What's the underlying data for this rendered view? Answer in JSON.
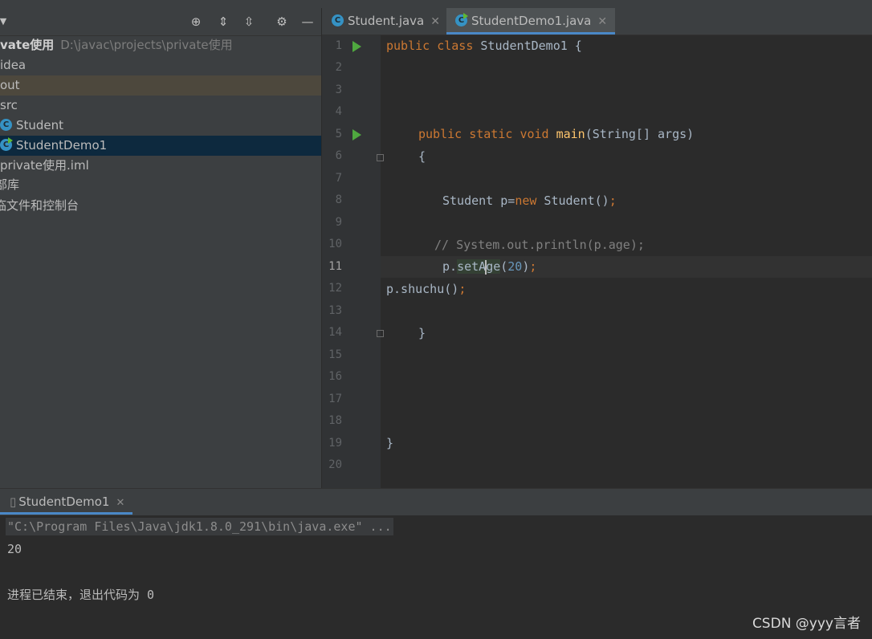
{
  "project": {
    "root_name": "vate使用",
    "root_path": "D:\\javac\\projects\\private使用",
    "items": [
      {
        "label": "idea"
      },
      {
        "label": "out"
      },
      {
        "label": "src"
      },
      {
        "label": "Student"
      },
      {
        "label": "StudentDemo1"
      },
      {
        "label": "private使用.iml"
      },
      {
        "label": "部库"
      },
      {
        "label": "临文件和控制台"
      }
    ]
  },
  "tabs": [
    {
      "label": "Student.java"
    },
    {
      "label": "StudentDemo1.java"
    }
  ],
  "editor": {
    "line_numbers": [
      "1",
      "2",
      "3",
      "4",
      "5",
      "6",
      "7",
      "8",
      "9",
      "10",
      "11",
      "12",
      "13",
      "14",
      "15",
      "16",
      "17",
      "18",
      "19",
      "20"
    ],
    "current_line": "11"
  },
  "code": {
    "l1_kw1": "public",
    "l1_kw2": "class",
    "l1_rest": "StudentDemo1 {",
    "l5_kw1": "public",
    "l5_kw2": "static",
    "l5_kw3": "void",
    "l5_fn": "main",
    "l5_rest": "(String[] args)",
    "l6": "{",
    "l8_a": "Student p=",
    "l8_kw": "new",
    "l8_b": " Student()",
    "l8_semi": ";",
    "l10": "// System.out.println(p.age);",
    "l11_a": "p.",
    "l11_m1": "setA",
    "l11_m2": "ge",
    "l11_b": "(",
    "l11_num": "20",
    "l11_c": ")",
    "l11_semi": ";",
    "l12_a": "p.shuchu()",
    "l12_semi": ";",
    "l14": "}",
    "l19": "}"
  },
  "run": {
    "tab_label": "StudentDemo1",
    "command": "\"C:\\Program Files\\Java\\jdk1.8.0_291\\bin\\java.exe\" ...",
    "output": "20",
    "exit": "进程已结束，退出代码为 0"
  },
  "watermark": "CSDN @yyy言者",
  "colors": {
    "accent": "#4a88c7",
    "run_green": "#4fa83f"
  }
}
